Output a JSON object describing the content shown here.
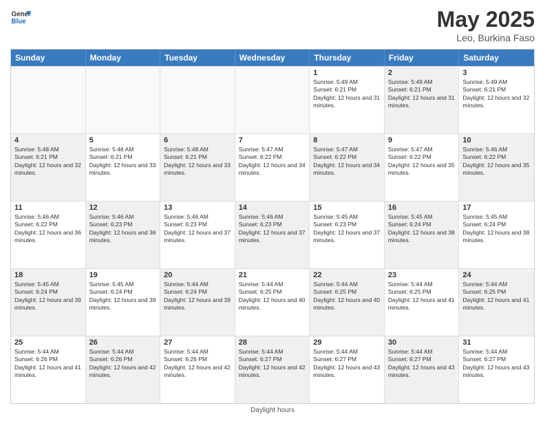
{
  "header": {
    "logo_general": "General",
    "logo_blue": "Blue",
    "title": "May 2025",
    "subtitle": "Leo, Burkina Faso"
  },
  "days_of_week": [
    "Sunday",
    "Monday",
    "Tuesday",
    "Wednesday",
    "Thursday",
    "Friday",
    "Saturday"
  ],
  "weeks": [
    [
      {
        "day": "",
        "info": "",
        "shaded": false,
        "empty": true
      },
      {
        "day": "",
        "info": "",
        "shaded": false,
        "empty": true
      },
      {
        "day": "",
        "info": "",
        "shaded": false,
        "empty": true
      },
      {
        "day": "",
        "info": "",
        "shaded": false,
        "empty": true
      },
      {
        "day": "1",
        "info": "Sunrise: 5:49 AM\nSunset: 6:21 PM\nDaylight: 12 hours and 31 minutes.",
        "shaded": false,
        "empty": false
      },
      {
        "day": "2",
        "info": "Sunrise: 5:49 AM\nSunset: 6:21 PM\nDaylight: 12 hours and 31 minutes.",
        "shaded": true,
        "empty": false
      },
      {
        "day": "3",
        "info": "Sunrise: 5:49 AM\nSunset: 6:21 PM\nDaylight: 12 hours and 32 minutes.",
        "shaded": false,
        "empty": false
      }
    ],
    [
      {
        "day": "4",
        "info": "Sunrise: 5:48 AM\nSunset: 6:21 PM\nDaylight: 12 hours and 32 minutes.",
        "shaded": true,
        "empty": false
      },
      {
        "day": "5",
        "info": "Sunrise: 5:48 AM\nSunset: 6:21 PM\nDaylight: 12 hours and 33 minutes.",
        "shaded": false,
        "empty": false
      },
      {
        "day": "6",
        "info": "Sunrise: 5:48 AM\nSunset: 6:21 PM\nDaylight: 12 hours and 33 minutes.",
        "shaded": true,
        "empty": false
      },
      {
        "day": "7",
        "info": "Sunrise: 5:47 AM\nSunset: 6:22 PM\nDaylight: 12 hours and 34 minutes.",
        "shaded": false,
        "empty": false
      },
      {
        "day": "8",
        "info": "Sunrise: 5:47 AM\nSunset: 6:22 PM\nDaylight: 12 hours and 34 minutes.",
        "shaded": true,
        "empty": false
      },
      {
        "day": "9",
        "info": "Sunrise: 5:47 AM\nSunset: 6:22 PM\nDaylight: 12 hours and 35 minutes.",
        "shaded": false,
        "empty": false
      },
      {
        "day": "10",
        "info": "Sunrise: 5:46 AM\nSunset: 6:22 PM\nDaylight: 12 hours and 35 minutes.",
        "shaded": true,
        "empty": false
      }
    ],
    [
      {
        "day": "11",
        "info": "Sunrise: 5:46 AM\nSunset: 6:22 PM\nDaylight: 12 hours and 36 minutes.",
        "shaded": false,
        "empty": false
      },
      {
        "day": "12",
        "info": "Sunrise: 5:46 AM\nSunset: 6:23 PM\nDaylight: 12 hours and 36 minutes.",
        "shaded": true,
        "empty": false
      },
      {
        "day": "13",
        "info": "Sunrise: 5:46 AM\nSunset: 6:23 PM\nDaylight: 12 hours and 37 minutes.",
        "shaded": false,
        "empty": false
      },
      {
        "day": "14",
        "info": "Sunrise: 5:46 AM\nSunset: 6:23 PM\nDaylight: 12 hours and 37 minutes.",
        "shaded": true,
        "empty": false
      },
      {
        "day": "15",
        "info": "Sunrise: 5:45 AM\nSunset: 6:23 PM\nDaylight: 12 hours and 37 minutes.",
        "shaded": false,
        "empty": false
      },
      {
        "day": "16",
        "info": "Sunrise: 5:45 AM\nSunset: 6:24 PM\nDaylight: 12 hours and 38 minutes.",
        "shaded": true,
        "empty": false
      },
      {
        "day": "17",
        "info": "Sunrise: 5:45 AM\nSunset: 6:24 PM\nDaylight: 12 hours and 38 minutes.",
        "shaded": false,
        "empty": false
      }
    ],
    [
      {
        "day": "18",
        "info": "Sunrise: 5:45 AM\nSunset: 6:24 PM\nDaylight: 12 hours and 39 minutes.",
        "shaded": true,
        "empty": false
      },
      {
        "day": "19",
        "info": "Sunrise: 5:45 AM\nSunset: 6:24 PM\nDaylight: 12 hours and 39 minutes.",
        "shaded": false,
        "empty": false
      },
      {
        "day": "20",
        "info": "Sunrise: 5:44 AM\nSunset: 6:24 PM\nDaylight: 12 hours and 39 minutes.",
        "shaded": true,
        "empty": false
      },
      {
        "day": "21",
        "info": "Sunrise: 5:44 AM\nSunset: 6:25 PM\nDaylight: 12 hours and 40 minutes.",
        "shaded": false,
        "empty": false
      },
      {
        "day": "22",
        "info": "Sunrise: 5:44 AM\nSunset: 6:25 PM\nDaylight: 12 hours and 40 minutes.",
        "shaded": true,
        "empty": false
      },
      {
        "day": "23",
        "info": "Sunrise: 5:44 AM\nSunset: 6:25 PM\nDaylight: 12 hours and 41 minutes.",
        "shaded": false,
        "empty": false
      },
      {
        "day": "24",
        "info": "Sunrise: 5:44 AM\nSunset: 6:25 PM\nDaylight: 12 hours and 41 minutes.",
        "shaded": true,
        "empty": false
      }
    ],
    [
      {
        "day": "25",
        "info": "Sunrise: 5:44 AM\nSunset: 6:26 PM\nDaylight: 12 hours and 41 minutes.",
        "shaded": false,
        "empty": false
      },
      {
        "day": "26",
        "info": "Sunrise: 5:44 AM\nSunset: 6:26 PM\nDaylight: 12 hours and 42 minutes.",
        "shaded": true,
        "empty": false
      },
      {
        "day": "27",
        "info": "Sunrise: 5:44 AM\nSunset: 6:26 PM\nDaylight: 12 hours and 42 minutes.",
        "shaded": false,
        "empty": false
      },
      {
        "day": "28",
        "info": "Sunrise: 5:44 AM\nSunset: 6:27 PM\nDaylight: 12 hours and 42 minutes.",
        "shaded": true,
        "empty": false
      },
      {
        "day": "29",
        "info": "Sunrise: 5:44 AM\nSunset: 6:27 PM\nDaylight: 12 hours and 43 minutes.",
        "shaded": false,
        "empty": false
      },
      {
        "day": "30",
        "info": "Sunrise: 5:44 AM\nSunset: 6:27 PM\nDaylight: 12 hours and 43 minutes.",
        "shaded": true,
        "empty": false
      },
      {
        "day": "31",
        "info": "Sunrise: 5:44 AM\nSunset: 6:27 PM\nDaylight: 12 hours and 43 minutes.",
        "shaded": false,
        "empty": false
      }
    ]
  ],
  "footer": "Daylight hours"
}
